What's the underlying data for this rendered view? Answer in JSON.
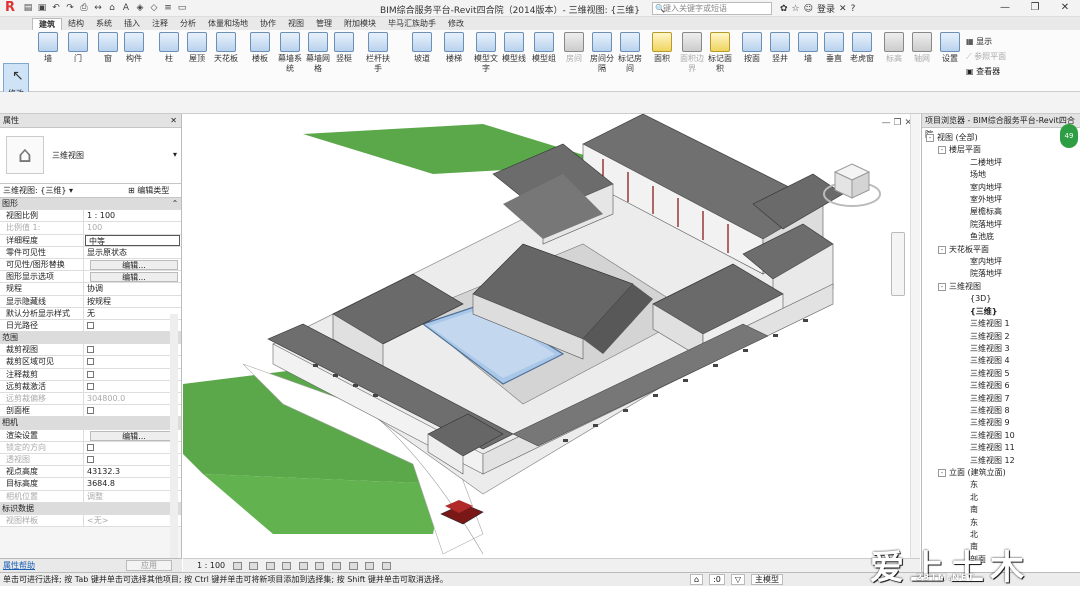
{
  "app": {
    "title": "BIM综合服务平台-Revit四合院（2014版本）- 三维视图: {三维}",
    "search_placeholder": "键入关键字或短语",
    "user": "登录",
    "help": "?"
  },
  "tabs": [
    "建筑",
    "结构",
    "系统",
    "插入",
    "注释",
    "分析",
    "体量和场地",
    "协作",
    "视图",
    "管理",
    "附加模块",
    "毕马汇族助手",
    "修改"
  ],
  "ribbon": {
    "modify": "修改",
    "buttons": [
      {
        "label": "墙",
        "dis": false,
        "ic": ""
      },
      {
        "label": "门",
        "dis": false,
        "ic": ""
      },
      {
        "label": "窗",
        "dis": false,
        "ic": ""
      },
      {
        "label": "构件",
        "dis": false,
        "ic": ""
      },
      {
        "label": "柱",
        "dis": false,
        "ic": ""
      },
      {
        "label": "屋顶",
        "dis": false,
        "ic": ""
      },
      {
        "label": "天花板",
        "dis": false,
        "ic": ""
      },
      {
        "label": "楼板",
        "dis": false,
        "ic": ""
      },
      {
        "label": "幕墙系统",
        "dis": false,
        "ic": ""
      },
      {
        "label": "幕墙网格",
        "dis": false,
        "ic": ""
      },
      {
        "label": "竖梃",
        "dis": false,
        "ic": ""
      },
      {
        "label": "栏杆扶手",
        "dis": false,
        "ic": ""
      },
      {
        "label": "坡道",
        "dis": false,
        "ic": ""
      },
      {
        "label": "楼梯",
        "dis": false,
        "ic": ""
      },
      {
        "label": "模型文字",
        "dis": false,
        "ic": ""
      },
      {
        "label": "模型线",
        "dis": false,
        "ic": ""
      },
      {
        "label": "模型组",
        "dis": false,
        "ic": ""
      },
      {
        "label": "房间",
        "dis": true,
        "ic": "g"
      },
      {
        "label": "房间分隔",
        "dis": false,
        "ic": ""
      },
      {
        "label": "标记房间",
        "dis": false,
        "ic": ""
      },
      {
        "label": "面积",
        "dis": false,
        "ic": "y"
      },
      {
        "label": "面积边界",
        "dis": true,
        "ic": "g"
      },
      {
        "label": "标记面积",
        "dis": false,
        "ic": "y"
      },
      {
        "label": "按面",
        "dis": false,
        "ic": ""
      },
      {
        "label": "竖井",
        "dis": false,
        "ic": ""
      },
      {
        "label": "墙",
        "dis": false,
        "ic": ""
      },
      {
        "label": "垂直",
        "dis": false,
        "ic": ""
      },
      {
        "label": "老虎窗",
        "dis": false,
        "ic": ""
      },
      {
        "label": "标高",
        "dis": true,
        "ic": "g"
      },
      {
        "label": "轴网",
        "dis": true,
        "ic": "g"
      },
      {
        "label": "设置",
        "dis": false,
        "ic": ""
      }
    ],
    "workplane": [
      "显示",
      "参照平面",
      "查看器"
    ]
  },
  "properties": {
    "header": "属性",
    "type_name": "三维视图",
    "filter": "三维视图: {三维}",
    "edit_type": "编辑类型",
    "rows": [
      {
        "sect": "图形"
      },
      {
        "k": "视图比例",
        "v": "1 : 100"
      },
      {
        "k": "比例值 1:",
        "v": "100",
        "dis": true
      },
      {
        "k": "详细程度",
        "v": "中等",
        "sel": true
      },
      {
        "k": "零件可见性",
        "v": "显示原状态"
      },
      {
        "k": "可见性/图形替换",
        "v": "编辑...",
        "btn": true
      },
      {
        "k": "图形显示选项",
        "v": "编辑...",
        "btn": true
      },
      {
        "k": "规程",
        "v": "协调"
      },
      {
        "k": "显示隐藏线",
        "v": "按规程"
      },
      {
        "k": "默认分析显示样式",
        "v": "无"
      },
      {
        "k": "日光路径",
        "chk": true
      },
      {
        "sect": "范围"
      },
      {
        "k": "裁剪视图",
        "chk": true
      },
      {
        "k": "裁剪区域可见",
        "chk": true
      },
      {
        "k": "注释裁剪",
        "chk": true
      },
      {
        "k": "远剪裁激活",
        "chk": true
      },
      {
        "k": "远剪裁偏移",
        "v": "304800.0",
        "dis": true
      },
      {
        "k": "剖面框",
        "chk": true
      },
      {
        "sect": "相机"
      },
      {
        "k": "渲染设置",
        "v": "编辑...",
        "btn": true
      },
      {
        "k": "锁定的方向",
        "chk": true,
        "dis": true
      },
      {
        "k": "透视图",
        "chk": true,
        "dis": true
      },
      {
        "k": "视点高度",
        "v": "43132.3"
      },
      {
        "k": "目标高度",
        "v": "3684.8"
      },
      {
        "k": "相机位置",
        "v": "调整",
        "dis": true
      },
      {
        "sect": "标识数据"
      },
      {
        "k": "视图样板",
        "v": "<无>",
        "dis": true
      }
    ],
    "help_link": "属性帮助",
    "apply": "应用"
  },
  "viewbar": {
    "scale": "1 : 100"
  },
  "browser": {
    "header": "项目浏览器 - BIM综合服务平台-Revit四合院",
    "tree": [
      {
        "lvl": 0,
        "ex": "-",
        "t": "视图 (全部)"
      },
      {
        "lvl": 1,
        "ex": "-",
        "t": "楼层平面"
      },
      {
        "lvl": 2,
        "t": "二楼地坪"
      },
      {
        "lvl": 2,
        "t": "场地"
      },
      {
        "lvl": 2,
        "t": "室内地坪"
      },
      {
        "lvl": 2,
        "t": "室外地坪"
      },
      {
        "lvl": 2,
        "t": "屋檐标高"
      },
      {
        "lvl": 2,
        "t": "院落地坪"
      },
      {
        "lvl": 2,
        "t": "鱼池底"
      },
      {
        "lvl": 1,
        "ex": "-",
        "t": "天花板平面"
      },
      {
        "lvl": 2,
        "t": "室内地坪"
      },
      {
        "lvl": 2,
        "t": "院落地坪"
      },
      {
        "lvl": 1,
        "ex": "-",
        "t": "三维视图"
      },
      {
        "lvl": 2,
        "t": "{3D}"
      },
      {
        "lvl": 2,
        "t": "{三维}",
        "bold": true
      },
      {
        "lvl": 2,
        "t": "三维视图 1"
      },
      {
        "lvl": 2,
        "t": "三维视图 2"
      },
      {
        "lvl": 2,
        "t": "三维视图 3"
      },
      {
        "lvl": 2,
        "t": "三维视图 4"
      },
      {
        "lvl": 2,
        "t": "三维视图 5"
      },
      {
        "lvl": 2,
        "t": "三维视图 6"
      },
      {
        "lvl": 2,
        "t": "三维视图 7"
      },
      {
        "lvl": 2,
        "t": "三维视图 8"
      },
      {
        "lvl": 2,
        "t": "三维视图 9"
      },
      {
        "lvl": 2,
        "t": "三维视图 10"
      },
      {
        "lvl": 2,
        "t": "三维视图 11"
      },
      {
        "lvl": 2,
        "t": "三维视图 12"
      },
      {
        "lvl": 1,
        "ex": "-",
        "t": "立面 (建筑立面)"
      },
      {
        "lvl": 2,
        "t": "东"
      },
      {
        "lvl": 2,
        "t": "北"
      },
      {
        "lvl": 2,
        "t": "南"
      },
      {
        "lvl": 2,
        "t": "东"
      },
      {
        "lvl": 2,
        "t": "北"
      },
      {
        "lvl": 2,
        "t": "南"
      },
      {
        "lvl": 2,
        "t": "剖面"
      }
    ]
  },
  "status": {
    "text": "单击可进行选择; 按 Tab 键并单击可选择其他项目; 按 Ctrl 键并单击可将新项目添加到选择集; 按 Shift 键并单击可取消选择。",
    "value": ":0",
    "model": "主模型"
  },
  "watermark": {
    "big": "爱上土木",
    "small": "23TM.NET"
  },
  "badge": "49"
}
